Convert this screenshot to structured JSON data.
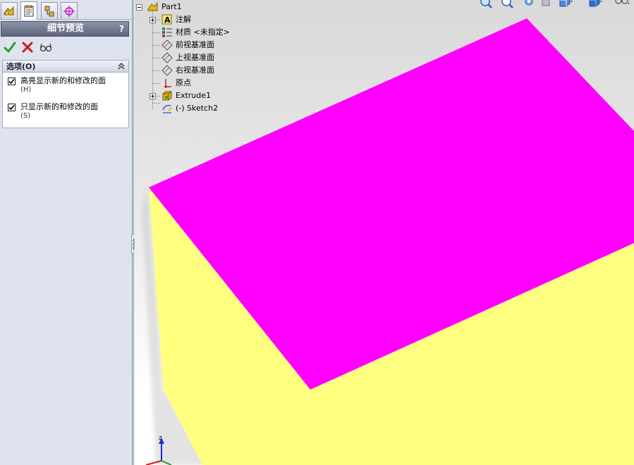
{
  "property_manager": {
    "tabs": [
      {
        "name": "feature-manager",
        "icon": "feature-tree-icon"
      },
      {
        "name": "property-manager",
        "icon": "property-manager-icon"
      },
      {
        "name": "configuration-manager",
        "icon": "configuration-manager-icon"
      },
      {
        "name": "dim-xpert-manager",
        "icon": "dimxpert-icon"
      }
    ],
    "title": "细节预览",
    "help_label": "?",
    "actions": {
      "ok_icon": "check-icon",
      "cancel_icon": "x-icon",
      "preview_icon": "glasses-icon"
    },
    "options": {
      "title": "选项(O)",
      "items": [
        {
          "label": "高亮显示新的和修改的面",
          "key": "(H)",
          "checked": true
        },
        {
          "label": "只显示新的和修改的面",
          "key": "(S)",
          "checked": true
        }
      ]
    }
  },
  "feature_tree": {
    "root": "Part1",
    "items": [
      {
        "label": "注解",
        "icon": "annotations-icon",
        "expandable": true
      },
      {
        "label": "材质 <未指定>",
        "icon": "material-icon",
        "expandable": false
      },
      {
        "label": "前视基准面",
        "icon": "plane-icon",
        "expandable": false
      },
      {
        "label": "上视基准面",
        "icon": "plane-icon",
        "expandable": false
      },
      {
        "label": "右视基准面",
        "icon": "plane-icon",
        "expandable": false
      },
      {
        "label": "原点",
        "icon": "origin-icon",
        "expandable": false
      },
      {
        "label": "Extrude1",
        "icon": "extrude-icon",
        "expandable": true
      },
      {
        "label": "(-) Sketch2",
        "icon": "sketch-icon",
        "expandable": false
      }
    ]
  },
  "view_toolbar": {
    "buttons": [
      "zoom-to-fit-icon",
      "zoom-to-area-icon",
      "previous-view-icon",
      "section-view-icon",
      "view-orientation-icon",
      "display-style-icon",
      "hide-show-items-icon"
    ]
  },
  "model": {
    "top_face_color": "#ff00ff",
    "side_face_color": "#ffff80",
    "top_face_meaning": "new/modified face (highlighted)",
    "side_face_meaning": "unchanged face"
  },
  "triad": {
    "axis_label": "Z"
  }
}
